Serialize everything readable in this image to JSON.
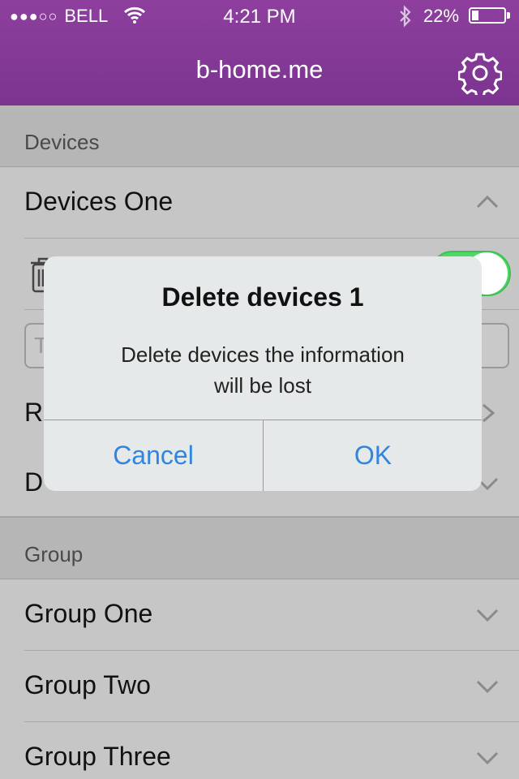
{
  "status_bar": {
    "carrier": "BELL",
    "signal_dots": "●●●○○",
    "time": "4:21 PM",
    "battery_percent": "22%",
    "battery_level": 0.22
  },
  "header": {
    "title": "b-home.me"
  },
  "devices_section": {
    "header": "Devices",
    "device_one": "Devices One",
    "name_placeholder_letter": "T",
    "row_r_letter": "R",
    "row_d_letter": "D",
    "toggle_on": true
  },
  "group_section": {
    "header": "Group",
    "items": [
      {
        "label": "Group One"
      },
      {
        "label": "Group Two"
      },
      {
        "label": "Group Three"
      }
    ]
  },
  "dialog": {
    "title": "Delete devices 1",
    "message_line1": "Delete devices the information",
    "message_line2": "will be lost",
    "cancel_label": "Cancel",
    "ok_label": "OK"
  },
  "colors": {
    "header": "#8e3f9e",
    "toggle": "#4cd964",
    "button_text": "#2f86e0"
  }
}
